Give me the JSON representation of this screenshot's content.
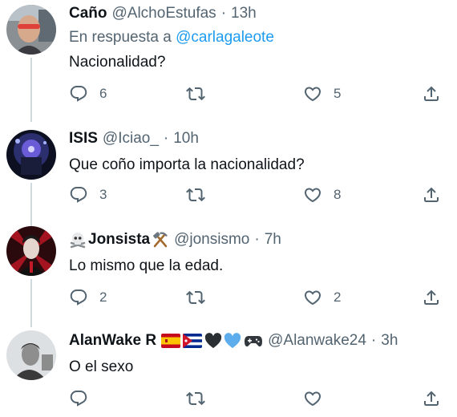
{
  "tweets": [
    {
      "name": "Caño",
      "handle": "@AlchoEstufas",
      "time": "13h",
      "replying_prefix": "En respuesta a ",
      "replying_to": "@carlagaleote",
      "text": "Nacionalidad?",
      "replies": "6",
      "retweets": "",
      "likes": "5"
    },
    {
      "name": "ISIS",
      "handle": "@Iciao_",
      "time": "10h",
      "text": "Que coño importa la nacionalidad?",
      "replies": "3",
      "retweets": "",
      "likes": "8"
    },
    {
      "name": "Jonsista",
      "name_icons": [
        "skull-crossbones-icon",
        "hammer-pick-icon"
      ],
      "handle": "@jonsismo",
      "time": "7h",
      "text": "Lo mismo que la edad.",
      "replies": "2",
      "retweets": "",
      "likes": "2"
    },
    {
      "name": "AlanWake R",
      "name_icons": [
        "spain-flag-icon",
        "cuba-flag-icon",
        "black-heart-icon",
        "blue-heart-icon",
        "gamepad-icon"
      ],
      "handle": "@Alanwake24",
      "time": "3h",
      "text": "O el sexo",
      "replies": "",
      "retweets": "",
      "likes": ""
    }
  ],
  "colors": {
    "text": "#0f1419",
    "secondary": "#536471",
    "link": "#1d9bf0",
    "thread_line": "#cfd9de"
  },
  "separator": "·"
}
